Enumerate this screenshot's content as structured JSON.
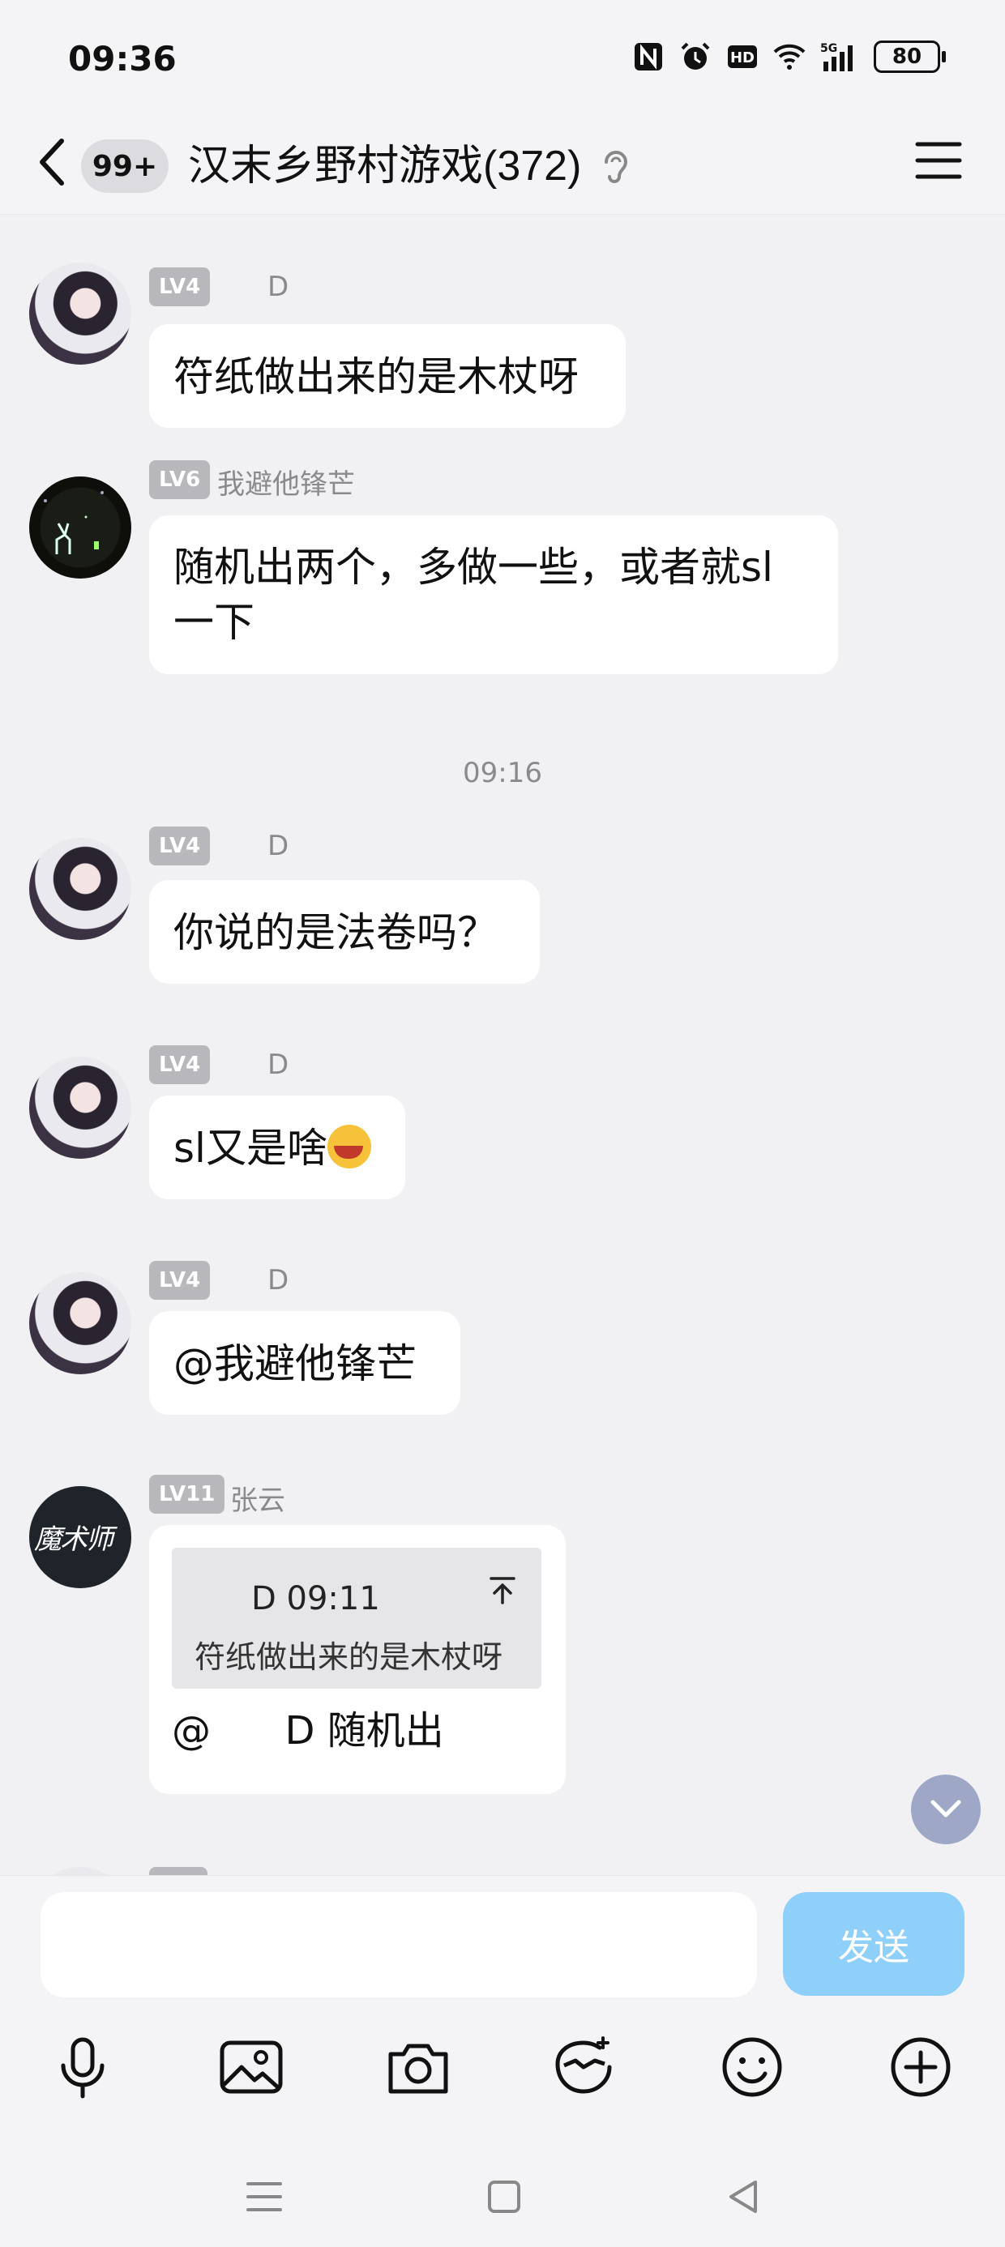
{
  "status_bar": {
    "time": "09:36",
    "battery": "80"
  },
  "header": {
    "back_count": "99+",
    "title": "汉末乡野村游戏(372)"
  },
  "messages": [
    {
      "level": "LV4",
      "nick": "D",
      "text": "符纸做出来的是木杖呀"
    },
    {
      "level": "LV6",
      "nick": "我避他锋芒",
      "text_line1": "随机出两个，多做一些，或者就sl",
      "text_line2": "一下"
    },
    {
      "time_separator": "09:16"
    },
    {
      "level": "LV4",
      "nick": "D",
      "text": "你说的是法卷吗？"
    },
    {
      "level": "LV4",
      "nick": "D",
      "text": "sl又是啥"
    },
    {
      "level": "LV4",
      "nick": "D",
      "text": "@我避他锋芒"
    },
    {
      "level": "LV11",
      "nick": "张云",
      "quote_head": "D 09:11",
      "quote_text": "符纸做出来的是木杖呀",
      "text": "@      D 随机出"
    }
  ],
  "avatar_text": "魔术师",
  "composer": {
    "send_label": "发送",
    "input_value": ""
  },
  "toolbar_icons": [
    "microphone-icon",
    "image-icon",
    "camera-icon",
    "sticker-icon",
    "emoji-icon",
    "plus-icon"
  ],
  "colors": {
    "background": "#f1f1f4",
    "send_button": "#8fd0fa",
    "level_badge": "#b8b8bc"
  }
}
